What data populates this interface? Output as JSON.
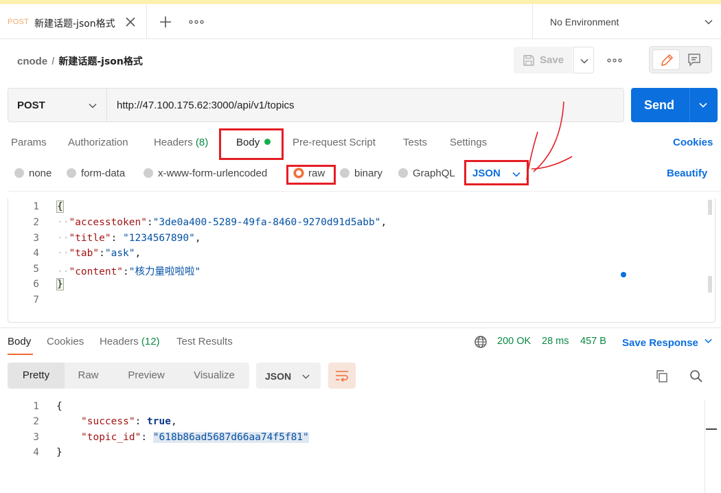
{
  "tab": {
    "method": "POST",
    "title": "新建话题-json格式",
    "close_icon": "close-icon"
  },
  "environment": {
    "label": "No Environment"
  },
  "breadcrumb": {
    "collection": "cnode",
    "separator": "/",
    "request": "新建话题-json格式"
  },
  "actions": {
    "save_label": "Save"
  },
  "request": {
    "method": "POST",
    "url": "http://47.100.175.62:3000/api/v1/topics",
    "send_label": "Send"
  },
  "request_tabs": {
    "params": "Params",
    "authorization": "Authorization",
    "headers": "Headers",
    "headers_count": "(8)",
    "body": "Body",
    "pre_request": "Pre-request Script",
    "tests": "Tests",
    "settings": "Settings",
    "cookies": "Cookies"
  },
  "body_types": {
    "none": "none",
    "form_data": "form-data",
    "urlencoded": "x-www-form-urlencoded",
    "raw": "raw",
    "binary": "binary",
    "graphql": "GraphQL",
    "language": "JSON",
    "beautify": "Beautify",
    "selected": "raw"
  },
  "request_body": {
    "line_numbers": [
      "1",
      "2",
      "3",
      "4",
      "5",
      "6",
      "7"
    ],
    "open_brace": "{",
    "close_brace": "}",
    "fields": [
      {
        "key": "\"accesstoken\"",
        "sep": ":",
        "value": "\"3de0a400-5289-49fa-8460-9270d91d5abb\"",
        "trail": ","
      },
      {
        "key": "\"title\"",
        "sep": ": ",
        "value": "\"1234567890\"",
        "trail": ","
      },
      {
        "key": "\"tab\"",
        "sep": ":",
        "value": "\"ask\"",
        "trail": ","
      },
      {
        "key": "\"content\"",
        "sep": ":",
        "value": "\"核力量啦啦啦\"",
        "trail": ""
      }
    ]
  },
  "response_tabs": {
    "body": "Body",
    "cookies": "Cookies",
    "headers": "Headers",
    "headers_count": "(12)",
    "test_results": "Test Results"
  },
  "response_status": {
    "status": "200 OK",
    "time": "28 ms",
    "size": "457 B",
    "save_response": "Save Response"
  },
  "response_view": {
    "pretty": "Pretty",
    "raw": "Raw",
    "preview": "Preview",
    "visualize": "Visualize",
    "format": "JSON"
  },
  "response_body": {
    "line_numbers": [
      "1",
      "2",
      "3",
      "4"
    ],
    "open_brace": "{",
    "close_brace": "}",
    "success_key": "\"success\"",
    "success_value": "true",
    "topic_key": "\"topic_id\"",
    "topic_value": "\"618b86ad5687d66aa74f5f81\""
  },
  "colors": {
    "accent": "#0b6fde",
    "post_method": "#f2a86a",
    "status_ok": "#0a8a44",
    "annotation": "#e51d24",
    "active_tab": "#f06b34"
  }
}
